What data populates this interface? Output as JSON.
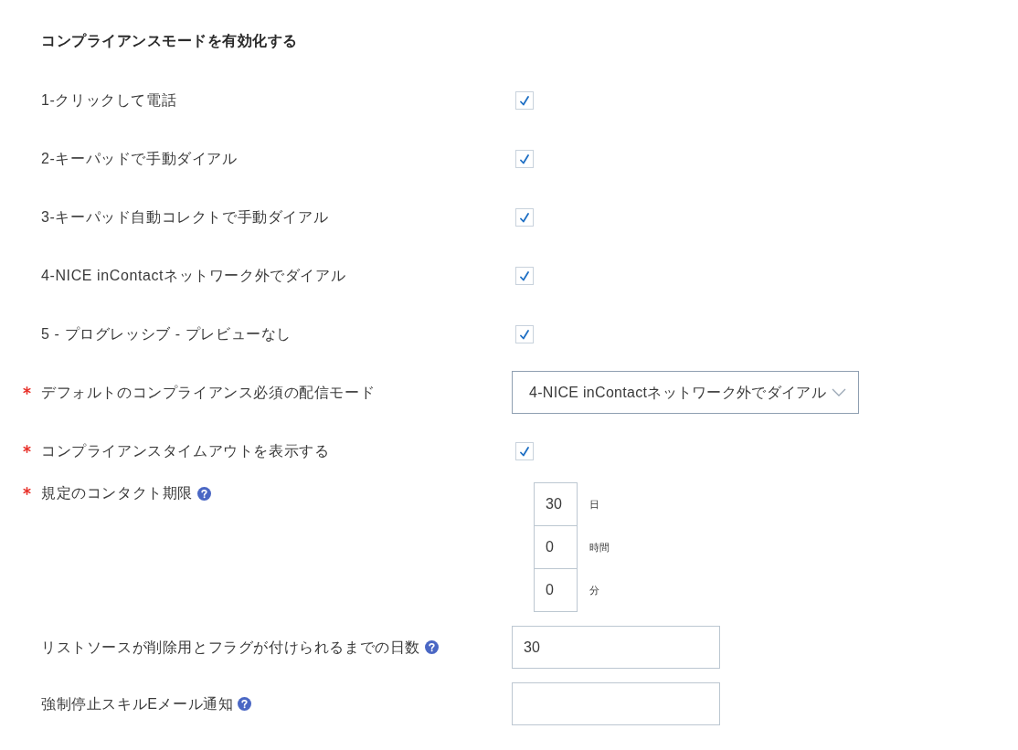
{
  "heading": "コンプライアンスモードを有効化する",
  "modes": [
    {
      "label": "1-クリックして電話",
      "checked": true
    },
    {
      "label": "2-キーパッドで手動ダイアル",
      "checked": true
    },
    {
      "label": "3-キーパッド自動コレクトで手動ダイアル",
      "checked": true
    },
    {
      "label": "4-NICE inContactネットワーク外でダイアル",
      "checked": true
    },
    {
      "label": "5 - プログレッシブ - プレビューなし",
      "checked": true
    }
  ],
  "fields": [
    {
      "kind": "select",
      "required": true,
      "help": false,
      "label": "デフォルトのコンプライアンス必須の配信モード",
      "value": "4-NICE inContactネットワーク外でダイアル"
    },
    {
      "kind": "checkbox",
      "required": true,
      "help": false,
      "label": "コンプライアンスタイムアウトを表示する",
      "checked": true
    },
    {
      "kind": "duration",
      "required": true,
      "help": true,
      "label": "規定のコンタクト期限",
      "parts": [
        {
          "value": "30",
          "unit": "日"
        },
        {
          "value": "0",
          "unit": "時間"
        },
        {
          "value": "0",
          "unit": "分"
        }
      ]
    },
    {
      "kind": "text",
      "required": false,
      "help": true,
      "label": "リストソースが削除用とフラグが付けられるまでの日数",
      "value": "30"
    },
    {
      "kind": "text",
      "required": false,
      "help": true,
      "label": "強制停止スキルEメール通知"
    }
  ]
}
